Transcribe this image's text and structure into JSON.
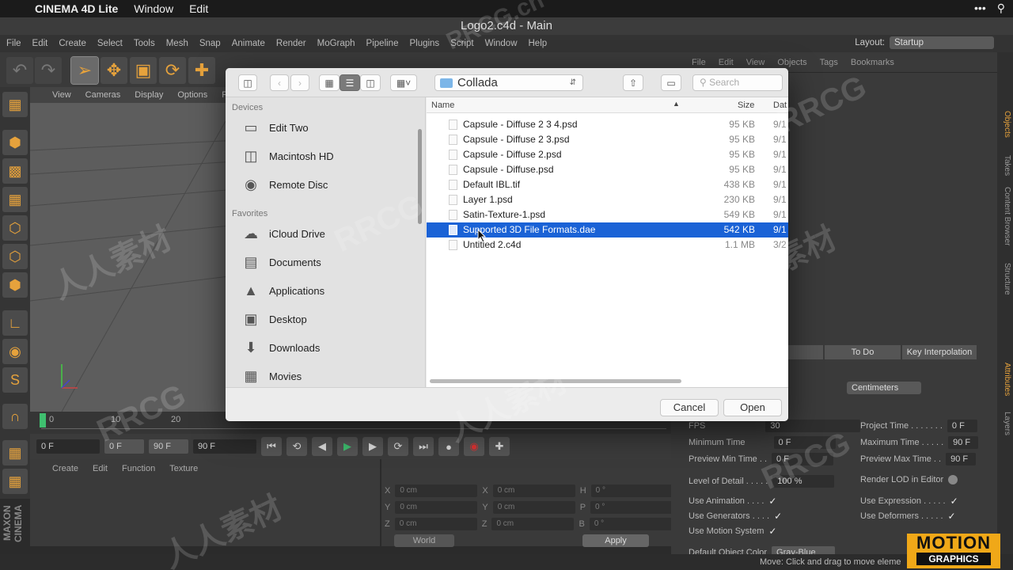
{
  "mac_menu": {
    "app": "CINEMA 4D Lite",
    "items": [
      "Window",
      "Edit"
    ]
  },
  "window_title": "Logo2.c4d - Main",
  "c4d_menu": [
    "File",
    "Edit",
    "Create",
    "Select",
    "Tools",
    "Mesh",
    "Snap",
    "Animate",
    "Render",
    "MoGraph",
    "Pipeline",
    "Plugins",
    "Script",
    "Window",
    "Help"
  ],
  "layout": {
    "label": "Layout:",
    "value": "Startup"
  },
  "object_menu": [
    "File",
    "Edit",
    "View",
    "Objects",
    "Tags",
    "Bookmarks"
  ],
  "right_vtabs": [
    "Objects",
    "Takes",
    "Content Browser",
    "Structure",
    "Attributes",
    "Layers"
  ],
  "viewport_menu": [
    "View",
    "Cameras",
    "Display",
    "Options",
    "Fil"
  ],
  "timeline_ticks": [
    "0",
    "10",
    "20"
  ],
  "transport": {
    "start": "0 F",
    "range_start": "0 F",
    "range_end": "90 F",
    "end": "90 F"
  },
  "material_menu": [
    "Create",
    "Edit",
    "Function",
    "Texture"
  ],
  "coords": {
    "rows": [
      {
        "a": "X",
        "av": "0 cm",
        "b": "X",
        "bv": "0 cm",
        "c": "H",
        "cv": "0 °"
      },
      {
        "a": "Y",
        "av": "0 cm",
        "b": "Y",
        "bv": "0 cm",
        "c": "P",
        "cv": "0 °"
      },
      {
        "a": "Z",
        "av": "0 cm",
        "b": "Z",
        "bv": "0 cm",
        "c": "B",
        "cv": "0 °"
      }
    ],
    "world": "World",
    "apply": "Apply"
  },
  "attributes": {
    "tabs": [
      "o",
      "To Do",
      "Key Interpolation"
    ],
    "units": "Centimeters",
    "fields": {
      "fps_label": "FPS",
      "fps": "30",
      "project_time_label": "Project Time . . . . . . .",
      "project_time": "0 F",
      "min_time_label": "Minimum Time",
      "min_time": "0 F",
      "max_time_label": "Maximum Time . . . . .",
      "max_time": "90 F",
      "preview_min_label": "Preview Min Time . .",
      "preview_min": "0 F",
      "preview_max_label": "Preview Max Time . .",
      "preview_max": "90 F",
      "lod_label": "Level of Detail . . . . .",
      "lod": "100 %",
      "render_lod_label": "Render LOD in Editor",
      "use_anim_label": "Use Animation . . . .",
      "use_expr_label": "Use Expression . . . . .",
      "use_gen_label": "Use Generators . . . .",
      "use_def_label": "Use Deformers . . . . .",
      "use_motion_label": "Use Motion System",
      "default_color_label": "Default Object Color",
      "default_color": "Gray-Blue"
    }
  },
  "status": "Move: Click and drag to move eleme",
  "logo_text": "MAXON CINEMA",
  "badge": {
    "line1": "MOTION",
    "line2": "GRAPHICS"
  },
  "dialog": {
    "path": "Collada",
    "search_placeholder": "Search",
    "sidebar": {
      "devices_header": "Devices",
      "devices": [
        "Edit Two",
        "Macintosh HD",
        "Remote Disc"
      ],
      "favorites_header": "Favorites",
      "favorites": [
        "iCloud Drive",
        "Documents",
        "Applications",
        "Desktop",
        "Downloads",
        "Movies"
      ]
    },
    "columns": {
      "name": "Name",
      "size": "Size",
      "date": "Dat"
    },
    "files": [
      {
        "name": "Capsule - Diffuse 2 3 4.psd",
        "size": "95 KB",
        "date": "9/1"
      },
      {
        "name": "Capsule - Diffuse 2 3.psd",
        "size": "95 KB",
        "date": "9/1"
      },
      {
        "name": "Capsule - Diffuse 2.psd",
        "size": "95 KB",
        "date": "9/1"
      },
      {
        "name": "Capsule - Diffuse.psd",
        "size": "95 KB",
        "date": "9/1"
      },
      {
        "name": "Default IBL.tif",
        "size": "438 KB",
        "date": "9/1"
      },
      {
        "name": "Layer 1.psd",
        "size": "230 KB",
        "date": "9/1"
      },
      {
        "name": "Satin-Texture-1.psd",
        "size": "549 KB",
        "date": "9/1"
      },
      {
        "name": "Supported 3D File Formats.dae",
        "size": "542 KB",
        "date": "9/1"
      },
      {
        "name": "Untitled 2.c4d",
        "size": "1.1 MB",
        "date": "3/2"
      }
    ],
    "selected_index": 7,
    "cancel": "Cancel",
    "open": "Open"
  },
  "watermark": {
    "text1": "RRCG",
    "text2": "人人素材",
    "text3": "RRCG.cn"
  }
}
